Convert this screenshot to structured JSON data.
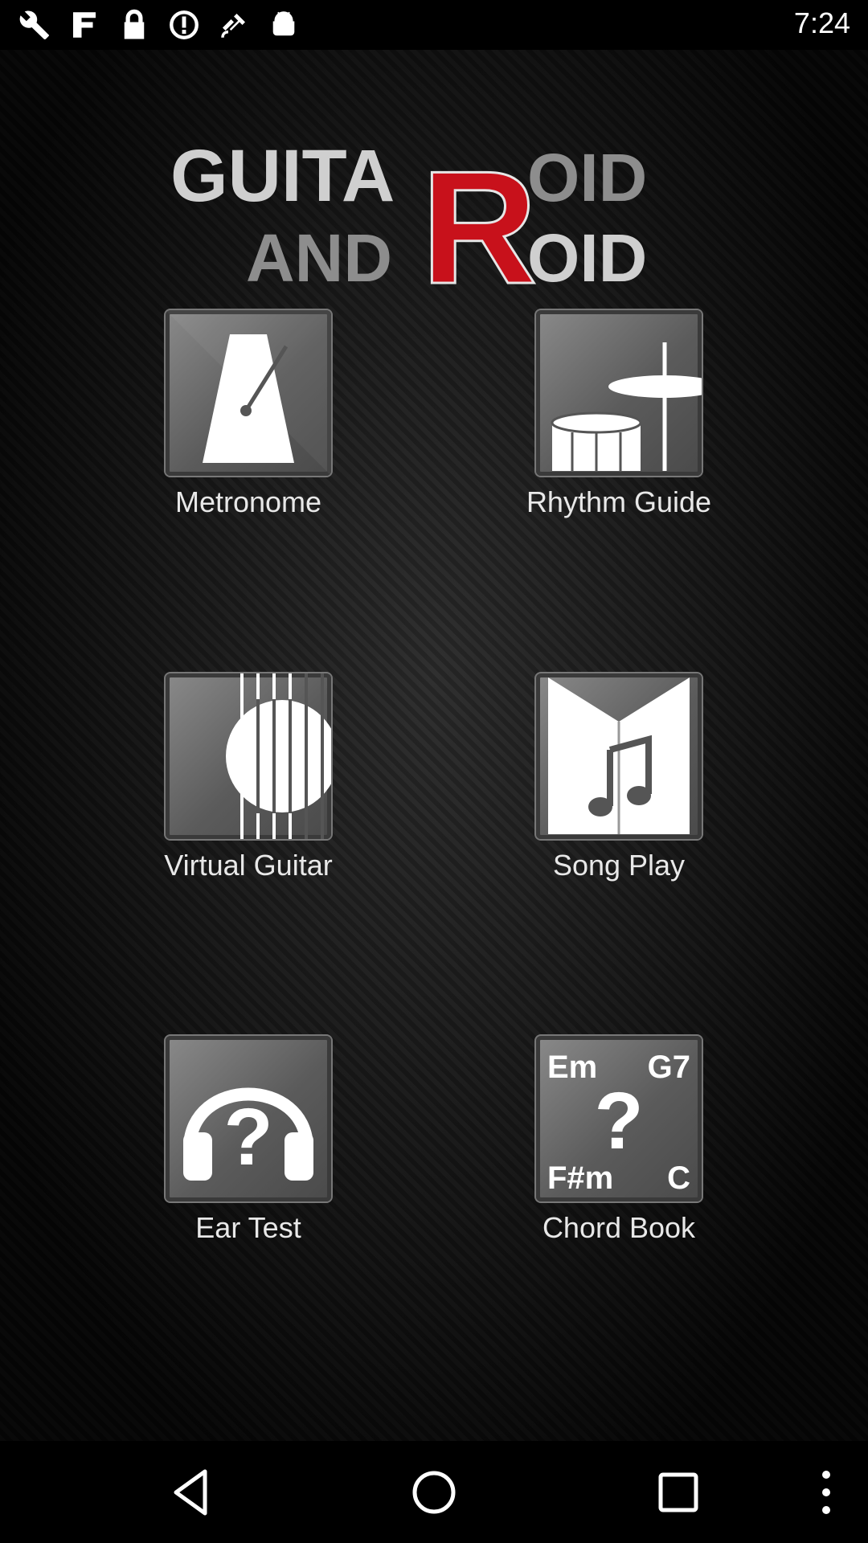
{
  "status_bar": {
    "time": "7:24",
    "icons": [
      "wrench-icon",
      "document-icon",
      "lock-icon",
      "alert-icon",
      "satellite-icon",
      "android-icon"
    ]
  },
  "app": {
    "logo_text_line1": "GUITA",
    "logo_text_line2": "AND",
    "logo_big_letter": "R",
    "logo_suffix_line1": "OID",
    "logo_suffix_line2": "OID",
    "brand_color": "#c8111b"
  },
  "menu": {
    "metronome": "Metronome",
    "rhythm_guide": "Rhythm Guide",
    "virtual_guitar": "Virtual Guitar",
    "song_play": "Song Play",
    "ear_test": "Ear Test",
    "chord_book": "Chord Book"
  },
  "chord_book_icon": {
    "top_left": "Em",
    "top_right": "G7",
    "bottom_left": "F#m",
    "bottom_right": "C",
    "center": "?"
  },
  "nav_bar": {
    "icons": [
      "back-icon",
      "home-icon",
      "recents-icon",
      "more-icon"
    ]
  }
}
